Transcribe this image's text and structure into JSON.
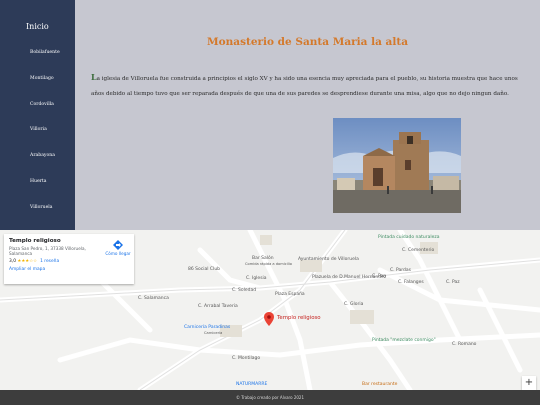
{
  "sidebar": {
    "home": "Inicio",
    "items": [
      {
        "label": "Bobilafuente"
      },
      {
        "label": "Montilago"
      },
      {
        "label": "Cordovilla"
      },
      {
        "label": "Villoria"
      },
      {
        "label": "Arabayona"
      },
      {
        "label": "Huerta"
      },
      {
        "label": "Villoruela"
      }
    ]
  },
  "main": {
    "title": "Monasterio de Santa Maria la alta",
    "first_letter": "L",
    "paragraph": "a iglesia de Villoruela fue construida a principios el siglo XV y ha sido una esencia muy apreciada para el pueblo, su historia muestra que hace unos años debido al tiempo tuvo que ser reparada después de que una de sus paredes se desprendiese durante una misa, algo que no dejo ningun daño."
  },
  "map": {
    "card": {
      "title": "Templo religioso",
      "address": "Plaza San Pedro, 1, 37338 Villoruela, Salamanca",
      "rating": "3,0",
      "stars": "★★★☆☆",
      "reviews": "1 reseña",
      "bigger_map": "Ampliar el mapa",
      "directions": "Cómo llegar"
    },
    "labels": {
      "pintada_cuidado": "Pintada cuidado naturaleza",
      "bar_salon": "Bar Salón",
      "bar_salon_sub": "Comida rápida a domicilio",
      "ayuntamiento": "Ayuntamiento de Villoruela",
      "social_club": "86 Social Club",
      "plazuela": "Plazuela de D.Manuel Hernández",
      "plaza_espana": "Plaza España",
      "carniceria": "Carnicería Paradinas",
      "carniceria_sub": "Carnicería",
      "templo": "Templo religioso",
      "pintada_mezclate": "Pintada \"mezclate conmigo\"",
      "naturmarre": "NATURMARRE",
      "bar_restaurante": "Bar restaurante",
      "c_salamanca": "C. Salamanca",
      "c_montilago": "C. Montilago",
      "c_arrabal": "C. Arrabal Taveria",
      "c_soledad": "C. Soledad",
      "c_gloria": "C. Gloria",
      "c_iglesia": "C. Iglesia",
      "c_cementerio": "C. Cementerio",
      "c_paz": "C. Paz",
      "c_romano": "C. Romano",
      "c_pardas": "C. Pardas",
      "c_pan": "C. Pan",
      "c_falanges": "C. Falanges"
    },
    "zoom_in": "+"
  },
  "footer": "© Trabajo creado por Alvaro 2021"
}
